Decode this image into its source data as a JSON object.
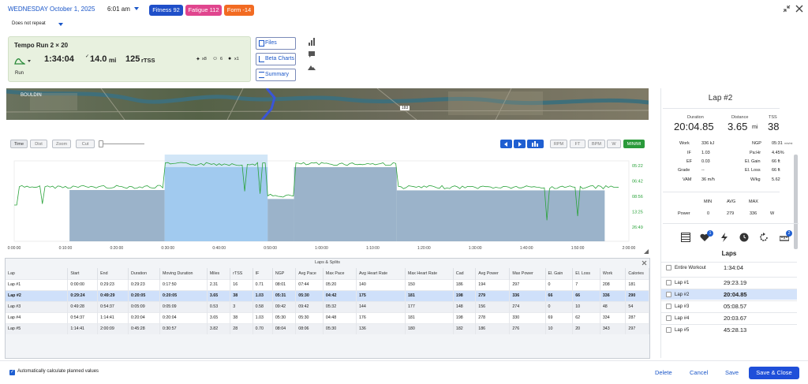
{
  "header": {
    "date": "WEDNESDAY October 1, 2025",
    "time": "6:01 am",
    "repeat": "Does not repeat",
    "badges": [
      {
        "label": "Fitness 92",
        "color": "#1f4fc9"
      },
      {
        "label": "Fatigue 112",
        "color": "#e0458e"
      },
      {
        "label": "Form -14",
        "color": "#f26b22"
      }
    ]
  },
  "workout": {
    "title": "Tempo Run 2 × 20",
    "duration": "1:34:04",
    "distance": "14.0",
    "distance_unit": "mi",
    "tss": "125",
    "tss_unit": "rTSS",
    "type": "Run",
    "count_a": "x8",
    "count_b": "6",
    "count_c": "x1"
  },
  "side_buttons": {
    "files": "Files",
    "beta_charts": "Beta Charts",
    "summary": "Summary"
  },
  "map": {
    "labels": [
      "BOULDIN",
      "183"
    ]
  },
  "chart_controls": {
    "left": [
      "Time",
      "Dist",
      "Zoom",
      "Cut"
    ],
    "right": [
      "RPM",
      "FT",
      "BPM",
      "W",
      "MIN/MI"
    ]
  },
  "chart_data": {
    "type": "area",
    "x_ticks": [
      "0:00:00",
      "0:10:00",
      "0:20:00",
      "0:30:00",
      "0:40:00",
      "0:50:00",
      "1:00:00",
      "1:10:00",
      "1:20:00",
      "1:30:00",
      "1:40:00",
      "1:50:00",
      "2:00:00"
    ],
    "y_ticks": [
      "05:22",
      "06:42",
      "08:56",
      "13:25",
      "26:49"
    ],
    "pace_color": "#2aa33a",
    "lap_color": "#7a9ab8",
    "selected_lap_color": "#9cc8ee",
    "laps": [
      {
        "name": "Lap #1",
        "start_min": 0.0,
        "end_min": 29.38,
        "pace": "08:01"
      },
      {
        "name": "Lap #2",
        "start_min": 29.38,
        "end_min": 49.48,
        "pace": "05:30"
      },
      {
        "name": "Lap #3",
        "start_min": 49.48,
        "end_min": 54.62,
        "pace": "09:42"
      },
      {
        "name": "Lap #4",
        "start_min": 54.62,
        "end_min": 74.68,
        "pace": "05:30"
      },
      {
        "name": "Lap #5",
        "start_min": 74.68,
        "end_min": 120.15,
        "pace": "08:04"
      }
    ]
  },
  "laps_table": {
    "title": "Laps & Splits",
    "columns": [
      "Lap",
      "Start",
      "End",
      "Duration",
      "Moving Duration",
      "Miles",
      "rTSS",
      "IF",
      "NGP",
      "Avg Pace",
      "Max Pace",
      "Avg Heart Rate",
      "Max Heart Rate",
      "Cad",
      "Avg Power",
      "Max Power",
      "El. Gain",
      "El. Loss",
      "Work",
      "Calories"
    ],
    "rows": [
      [
        "Lap #1",
        "0:00:00",
        "0:29:23",
        "0:29:23",
        "0:17:50",
        "2.31",
        "16",
        "0.71",
        "08:01",
        "07:44",
        "05:20",
        "140",
        "150",
        "186",
        "194",
        "297",
        "0",
        "7",
        "208",
        "181"
      ],
      [
        "Lap #2",
        "0:29:24",
        "0:49:29",
        "0:20:05",
        "0:20:05",
        "3.65",
        "38",
        "1.03",
        "05:31",
        "05:30",
        "04:42",
        "175",
        "181",
        "198",
        "279",
        "336",
        "66",
        "66",
        "336",
        "290"
      ],
      [
        "Lap #3",
        "0:49:28",
        "0:54:37",
        "0:05:09",
        "0:05:09",
        "0.53",
        "3",
        "0.58",
        "09:42",
        "09:42",
        "05:32",
        "144",
        "177",
        "148",
        "156",
        "274",
        "0",
        "10",
        "48",
        "54"
      ],
      [
        "Lap #4",
        "0:54:37",
        "1:14:41",
        "0:20:04",
        "0:20:04",
        "3.65",
        "38",
        "1.03",
        "05:30",
        "05:30",
        "04:48",
        "176",
        "181",
        "198",
        "278",
        "330",
        "69",
        "62",
        "334",
        "287"
      ],
      [
        "Lap #5",
        "1:14:41",
        "2:00:09",
        "0:45:28",
        "0:30:57",
        "3.82",
        "28",
        "0.70",
        "08:04",
        "08:06",
        "05:30",
        "136",
        "180",
        "182",
        "186",
        "276",
        "10",
        "20",
        "343",
        "297"
      ]
    ]
  },
  "lap_detail": {
    "title": "Lap #2",
    "duration_label": "Duration",
    "duration": "20:04.85",
    "distance_label": "Distance",
    "distance": "3.65",
    "distance_unit": "mi",
    "tss_label": "TSS",
    "tss": "38",
    "stats_left": [
      {
        "label": "Work",
        "value": "336 kJ"
      },
      {
        "label": "IF",
        "value": "1.03"
      },
      {
        "label": "EF",
        "value": "0.03"
      },
      {
        "label": "Grade",
        "value": "--"
      },
      {
        "label": "VAM",
        "value": "36 m/h"
      }
    ],
    "stats_right": [
      {
        "label": "NGP",
        "value": "05:31",
        "unit": "min/mi"
      },
      {
        "label": "Pa:Hr",
        "value": "4.45%"
      },
      {
        "label": "El. Gain",
        "value": "66 ft"
      },
      {
        "label": "El. Loss",
        "value": "66 ft"
      },
      {
        "label": "W/kg",
        "value": "5.62"
      }
    ],
    "mam_headers": [
      "MIN",
      "AVG",
      "MAX"
    ],
    "power_label": "Power",
    "power": [
      "0",
      "279",
      "336"
    ],
    "power_unit": "W",
    "tool_badges": [
      "1",
      "2"
    ]
  },
  "laps_list": {
    "title": "Laps",
    "items": [
      {
        "name": "Entire Workout",
        "time": "1:34:04"
      },
      {
        "name": "Lap #1",
        "time": "29:23.19"
      },
      {
        "name": "Lap #2",
        "time": "20:04.85"
      },
      {
        "name": "Lap #3",
        "time": "05:08.57"
      },
      {
        "name": "Lap #4",
        "time": "20:03.67"
      },
      {
        "name": "Lap #5",
        "time": "45:28.13"
      }
    ]
  },
  "footer": {
    "auto_calc": "Automatically calculate planned values",
    "delete": "Delete",
    "cancel": "Cancel",
    "save": "Save",
    "save_close": "Save & Close"
  }
}
